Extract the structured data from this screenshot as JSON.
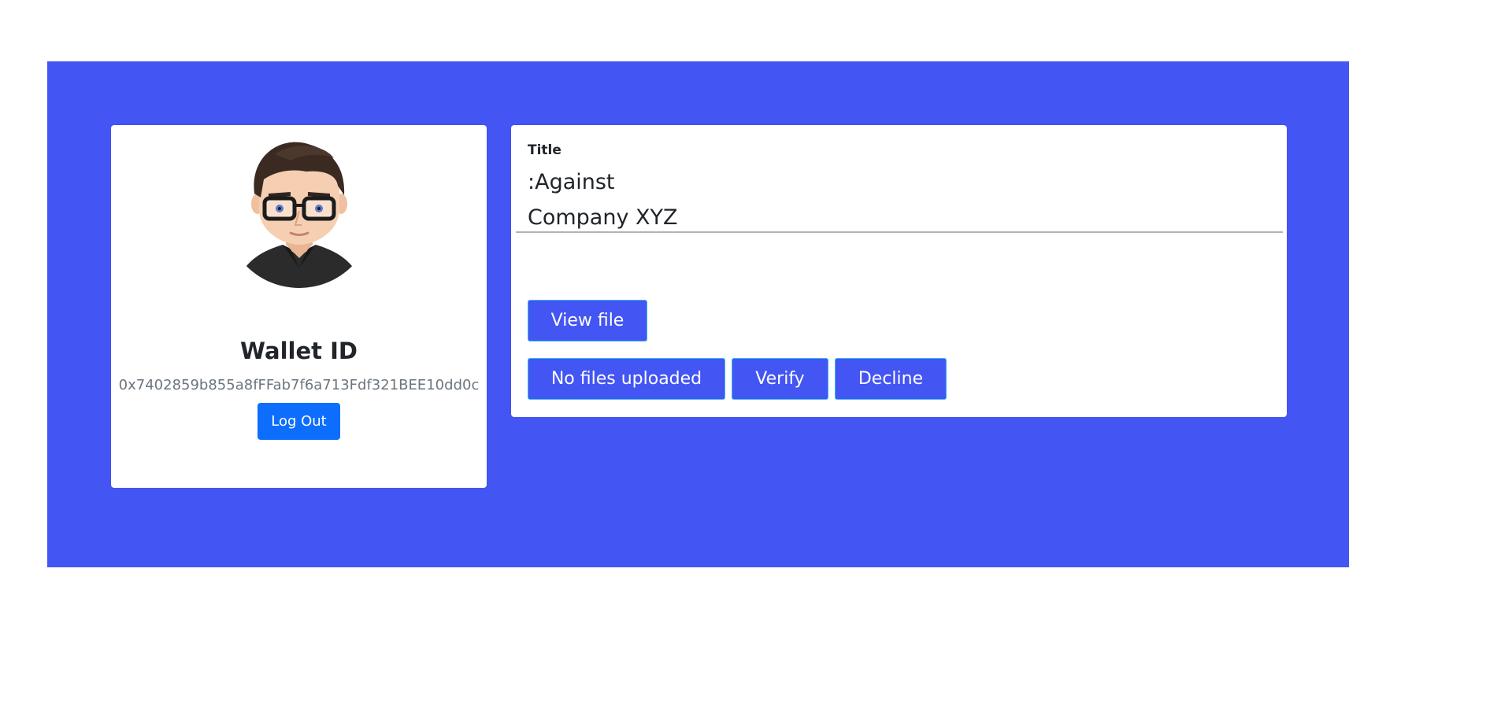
{
  "profile": {
    "avatar_icon": "user-avatar-icon",
    "wallet_heading": "Wallet ID",
    "wallet_address": "0x7402859b855a8fFFab7f6a713Fdf321BEE10dd0c",
    "logout_label": "Log Out"
  },
  "case": {
    "title_label": "Title",
    "title_value": ":Against\nCompany XYZ",
    "view_file_label": "View file",
    "no_files_label": "No files uploaded",
    "verify_label": "Verify",
    "decline_label": "Decline"
  },
  "colors": {
    "panel_blue": "#4355f2",
    "primary_button": "#0d6efd",
    "button_border": "#33b8f0"
  }
}
